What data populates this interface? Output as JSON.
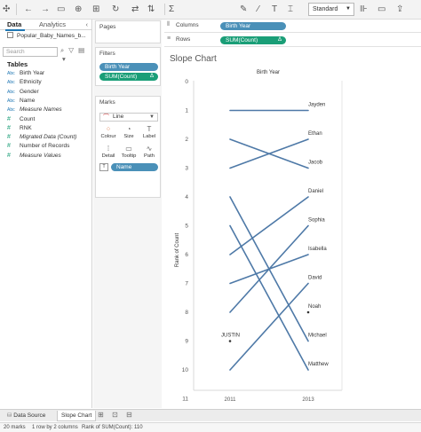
{
  "toolbar": {
    "back_icon": "back-arrow-icon",
    "forward_icon": "forward-arrow-icon",
    "fit_select": "Standard",
    "icons": [
      "undo-icon",
      "redo-icon",
      "save-icon",
      "new-datasource-icon",
      "pause-icon",
      "swap-icon",
      "sort-asc-icon",
      "sort-desc-icon",
      "highlight-icon",
      "group-icon",
      "label-icon",
      "fix-axes-icon",
      "show-me-icon",
      "presentation-icon",
      "download-icon"
    ]
  },
  "data_pane": {
    "tab_data": "Data",
    "tab_analytics": "Analytics",
    "datasource": "Popular_Baby_Names_b...",
    "search_placeholder": "Search",
    "tables_title": "Tables",
    "fields": [
      {
        "type": "Abc",
        "name": "Birth Year",
        "kind": "dimension"
      },
      {
        "type": "Abc",
        "name": "Ethnicity",
        "kind": "dimension"
      },
      {
        "type": "Abc",
        "name": "Gender",
        "kind": "dimension"
      },
      {
        "type": "Abc",
        "name": "Name",
        "kind": "dimension"
      },
      {
        "type": "Abc",
        "name": "Measure Names",
        "kind": "dimension",
        "italic": true
      },
      {
        "type": "#",
        "name": "Count",
        "kind": "measure"
      },
      {
        "type": "#",
        "name": "RNK",
        "kind": "measure"
      },
      {
        "type": "#",
        "name": "Migrated Data (Count)",
        "kind": "measure",
        "italic": true
      },
      {
        "type": "#",
        "name": "Number of Records",
        "kind": "measure"
      },
      {
        "type": "#",
        "name": "Measure Values",
        "kind": "measure",
        "italic": true
      }
    ]
  },
  "cards": {
    "pages_title": "Pages",
    "filters_title": "Filters",
    "filters": [
      {
        "label": "Birth Year",
        "kind": "dimension"
      },
      {
        "label": "SUM(Count)",
        "kind": "measure",
        "delta": "Δ"
      }
    ],
    "marks_title": "Marks",
    "mark_type": "Line",
    "mark_buttons": [
      {
        "label": "Colour",
        "icon": "colors-icon",
        "glyph": "⁘"
      },
      {
        "label": "Size",
        "icon": "size-icon",
        "glyph": "◔"
      },
      {
        "label": "Label",
        "icon": "label-icon",
        "glyph": "T"
      },
      {
        "label": "Detail",
        "icon": "detail-icon",
        "glyph": "⁞"
      },
      {
        "label": "Tooltip",
        "icon": "tooltip-icon",
        "glyph": "▭"
      },
      {
        "label": "Path",
        "icon": "path-icon",
        "glyph": "∿"
      }
    ],
    "detail_pill": "Name"
  },
  "shelves": {
    "columns_label": "Columns",
    "columns_pill": "Birth Year",
    "rows_label": "Rows",
    "rows_pill": "SUM(Count)",
    "rows_delta": "Δ"
  },
  "viz": {
    "title": "Slope Chart",
    "column_header": "Birth Year",
    "y_label": "Rank of Count"
  },
  "chart_data": {
    "type": "line",
    "x": [
      "2011",
      "2013"
    ],
    "ylabel": "Rank of Count",
    "xlabel": "Birth Year",
    "ylim": [
      0,
      11
    ],
    "y_reversed": true,
    "y_ticks": [
      0,
      1,
      2,
      3,
      4,
      5,
      6,
      7,
      8,
      9,
      10,
      11
    ],
    "grid": false,
    "line_color": "#4e79a7",
    "series": [
      {
        "name": "Jayden",
        "values": [
          1,
          1
        ]
      },
      {
        "name": "Ethan",
        "values": [
          3,
          2
        ]
      },
      {
        "name": "Jacob",
        "values": [
          2,
          3
        ]
      },
      {
        "name": "Daniel",
        "values": [
          6,
          4
        ]
      },
      {
        "name": "Sophia",
        "values": [
          8,
          5
        ]
      },
      {
        "name": "Isabella",
        "values": [
          7,
          6
        ]
      },
      {
        "name": "David",
        "values": [
          10,
          7
        ]
      },
      {
        "name": "Noah",
        "values": [
          null,
          8
        ]
      },
      {
        "name": "Michael",
        "values": [
          4,
          9
        ]
      },
      {
        "name": "Matthew",
        "values": [
          5,
          10
        ]
      },
      {
        "name": "JUSTIN",
        "values": [
          9,
          null
        ]
      }
    ]
  },
  "sheet_tabs": {
    "datasource": "Data Source",
    "active_sheet": "Slope Chart"
  },
  "status": {
    "marks": "20 marks",
    "rows_cols": "1 row by 2 columns",
    "sum": "Rank of SUM(Count): 110"
  }
}
